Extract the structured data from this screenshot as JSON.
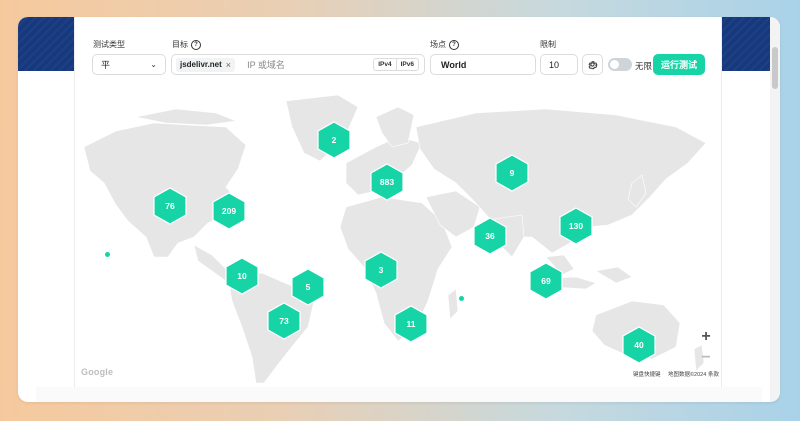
{
  "form": {
    "test_type": {
      "label": "测试类型",
      "value": "平"
    },
    "target": {
      "label": "目标",
      "tag": "jsdelivr.net",
      "placeholder": "IP 或域名",
      "ipv4": "IPv4",
      "ipv6": "IPv6"
    },
    "location": {
      "label": "场点",
      "value": "World"
    },
    "limit": {
      "label": "限制",
      "value": "10"
    },
    "unlimited_label": "无限",
    "run_button": "运行测试"
  },
  "map": {
    "clusters": [
      {
        "count": "2"
      },
      {
        "count": "883"
      },
      {
        "count": "9"
      },
      {
        "count": "76"
      },
      {
        "count": "209"
      },
      {
        "count": "36"
      },
      {
        "count": "130"
      },
      {
        "count": "3"
      },
      {
        "count": "10"
      },
      {
        "count": "5"
      },
      {
        "count": "69"
      },
      {
        "count": "73"
      },
      {
        "count": "11"
      },
      {
        "count": "40"
      }
    ],
    "zoom_in": "+",
    "zoom_out": "−",
    "google_logo": "Google",
    "attrib_shortcuts": "键盘快捷键",
    "attrib_data": "地图数据©2024",
    "attrib_terms": "条款"
  },
  "colors": {
    "accent": "#17d4a7",
    "land": "#e6e6e6",
    "header_band": "#1c3f86"
  }
}
